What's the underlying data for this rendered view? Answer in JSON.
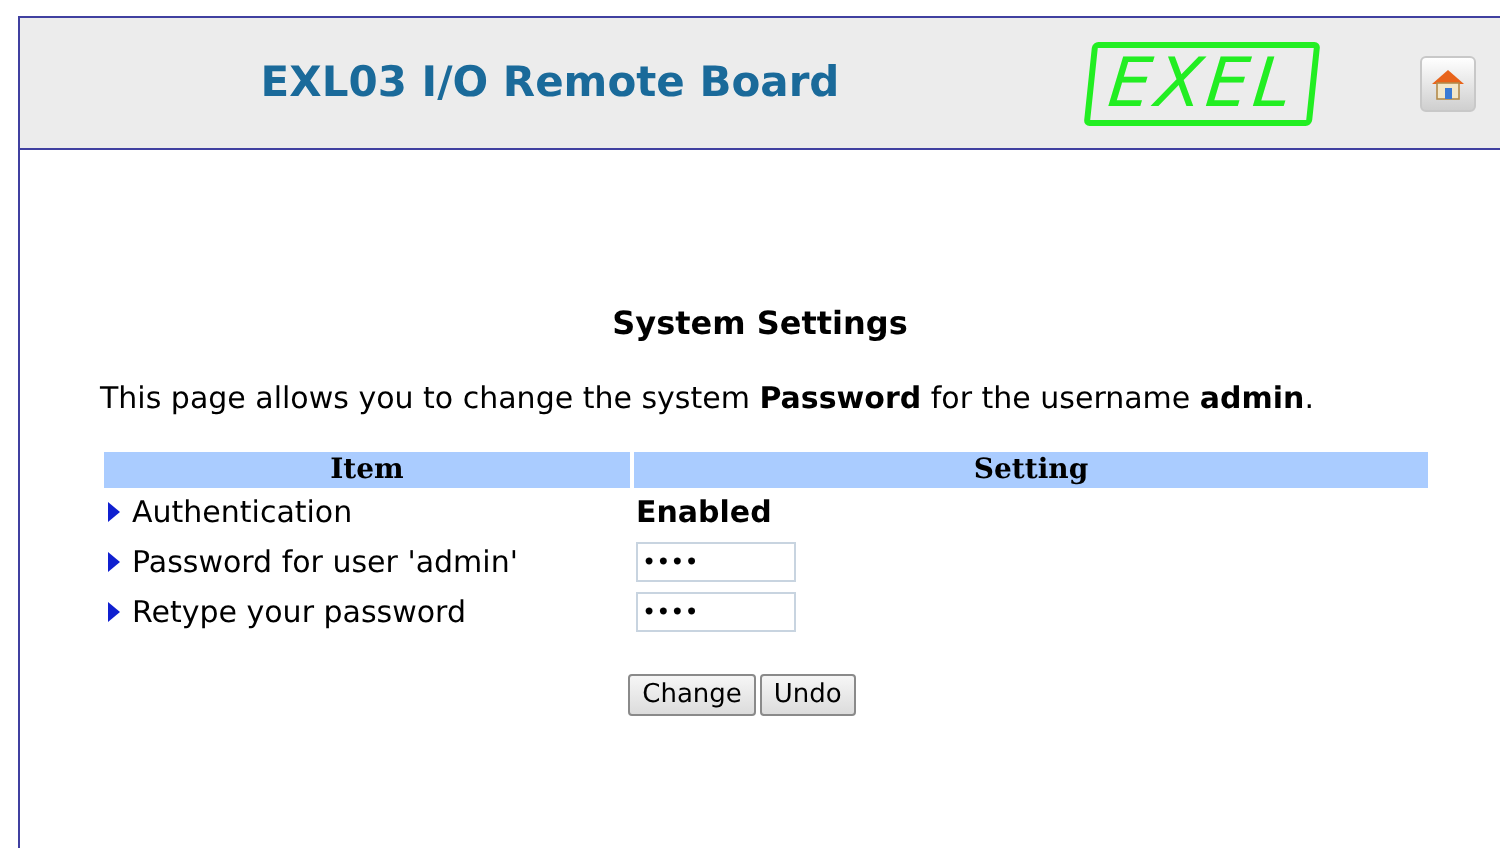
{
  "header": {
    "title": "EXL03 I/O Remote Board",
    "logo": "EXEL"
  },
  "page": {
    "heading": "System Settings",
    "description": "This page allows you to change the system **Password** for the username **admin**."
  },
  "table": {
    "columns": [
      "Item",
      "Setting"
    ],
    "rows": [
      {
        "kind": "text",
        "label": "Authentication",
        "value": "Enabled"
      },
      {
        "kind": "field",
        "label": "Password for user 'admin'",
        "value": "••••"
      },
      {
        "kind": "field",
        "label": "Retype your password",
        "value": "••••"
      }
    ]
  },
  "buttons": [
    "Change",
    "Undo"
  ]
}
